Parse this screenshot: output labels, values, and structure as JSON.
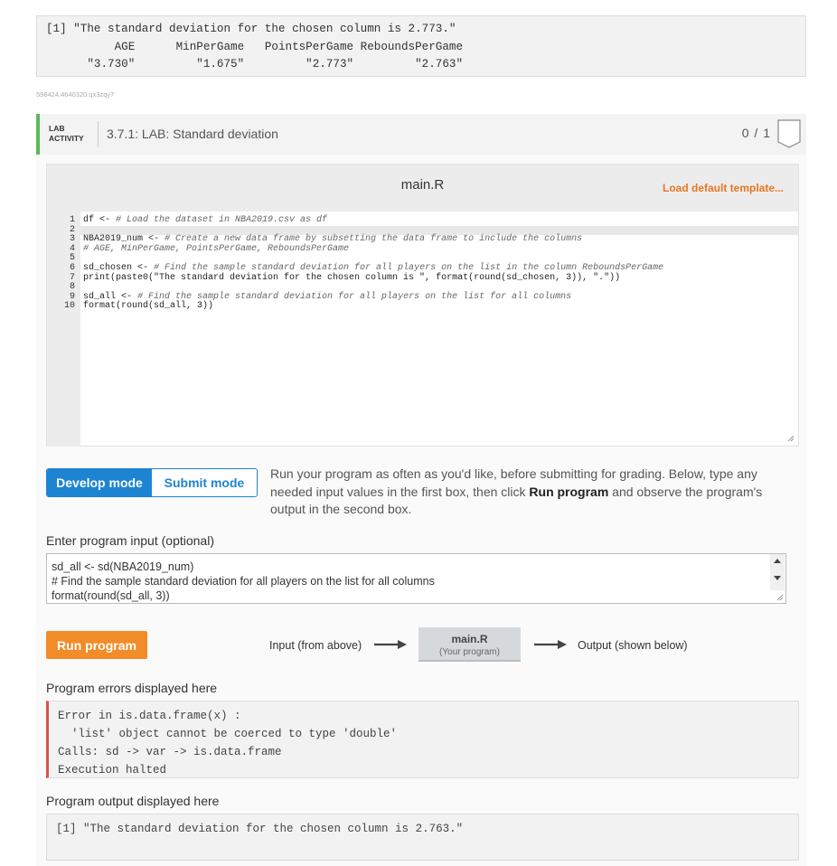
{
  "top_output": {
    "lines": [
      "[1] \"The standard deviation for the chosen column is 2.773.\"",
      "          AGE      MinPerGame   PointsPerGame ReboundsPerGame",
      "      \"3.730\"         \"1.675\"         \"2.773\"         \"2.763\""
    ]
  },
  "ref_id": "598424.4640320.qx3zqy7",
  "lab": {
    "tag_line1": "LAB",
    "tag_line2": "ACTIVITY",
    "title": "3.7.1: LAB: Standard deviation",
    "score": "0 / 1",
    "accent_color": "#5cb85c"
  },
  "editor": {
    "file_name": "main.R",
    "load_template_label": "Load default template...",
    "lines": [
      {
        "n": "1",
        "text": "df <- # Load the dataset in NBA2019.csv as df"
      },
      {
        "n": "2",
        "text": ""
      },
      {
        "n": "3",
        "text": "NBA2019_num <- # Create a new data frame by subsetting the data frame to include the columns"
      },
      {
        "n": "4",
        "text": "# AGE, MinPerGame, PointsPerGame, ReboundsPerGame"
      },
      {
        "n": "5",
        "text": ""
      },
      {
        "n": "6",
        "text": "sd_chosen <- # Find the sample standard deviation for all players on the list in the column ReboundsPerGame"
      },
      {
        "n": "7",
        "text": "print(paste0(\"The standard deviation for the chosen column is \", format(round(sd_chosen, 3)), \".\"))"
      },
      {
        "n": "8",
        "text": ""
      },
      {
        "n": "9",
        "text": "sd_all <- # Find the sample standard deviation for all players on the list for all columns"
      },
      {
        "n": "10",
        "text": "format(round(sd_all, 3))"
      }
    ]
  },
  "modes": {
    "develop_label": "Develop mode",
    "submit_label": "Submit mode",
    "desc_part1": "Run your program as often as you'd like, before submitting for grading. Below, type any needed input values in the first box, then click ",
    "desc_bold": "Run program",
    "desc_part2": " and observe the program's output in the second box."
  },
  "input_section": {
    "label": "Enter program input (optional)",
    "value": "sd_all <- sd(NBA2019_num)\n# Find the sample standard deviation for all players on the list for all columns\nformat(round(sd_all, 3))"
  },
  "run": {
    "button_label": "Run program",
    "input_label": "Input (from above)",
    "program_name": "main.R",
    "program_sub": "(Your program)",
    "output_label": "Output (shown below)",
    "button_color": "#f28c28"
  },
  "errors": {
    "label": "Program errors displayed here",
    "lines": [
      "Error in is.data.frame(x) :",
      "  'list' object cannot be coerced to type 'double'",
      "Calls: sd -> var -> is.data.frame",
      "Execution halted"
    ]
  },
  "output": {
    "label": "Program output displayed here",
    "lines": [
      "[1] \"The standard deviation for the chosen column is 2.763.\""
    ]
  }
}
